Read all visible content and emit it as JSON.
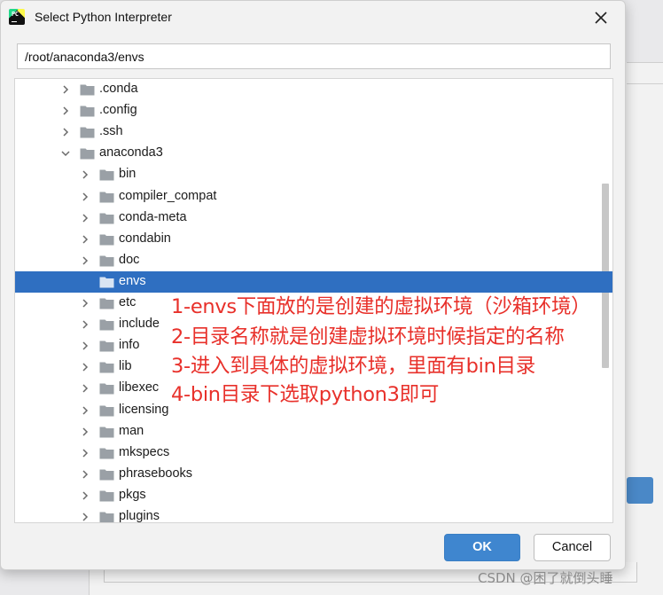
{
  "dialog": {
    "title": "Select Python Interpreter",
    "app_icon_text": "PC",
    "path": "/root/anaconda3/envs"
  },
  "tree": {
    "rows": [
      {
        "label": ".conda",
        "depth": 0,
        "expanded": false,
        "selected": false
      },
      {
        "label": ".config",
        "depth": 0,
        "expanded": false,
        "selected": false
      },
      {
        "label": ".ssh",
        "depth": 0,
        "expanded": false,
        "selected": false
      },
      {
        "label": "anaconda3",
        "depth": 0,
        "expanded": true,
        "selected": false
      },
      {
        "label": "bin",
        "depth": 1,
        "expanded": false,
        "selected": false
      },
      {
        "label": "compiler_compat",
        "depth": 1,
        "expanded": false,
        "selected": false
      },
      {
        "label": "conda-meta",
        "depth": 1,
        "expanded": false,
        "selected": false
      },
      {
        "label": "condabin",
        "depth": 1,
        "expanded": false,
        "selected": false
      },
      {
        "label": "doc",
        "depth": 1,
        "expanded": false,
        "selected": false
      },
      {
        "label": "envs",
        "depth": 1,
        "expanded": false,
        "selected": true,
        "no_chevron": true
      },
      {
        "label": "etc",
        "depth": 1,
        "expanded": false,
        "selected": false
      },
      {
        "label": "include",
        "depth": 1,
        "expanded": false,
        "selected": false
      },
      {
        "label": "info",
        "depth": 1,
        "expanded": false,
        "selected": false
      },
      {
        "label": "lib",
        "depth": 1,
        "expanded": false,
        "selected": false
      },
      {
        "label": "libexec",
        "depth": 1,
        "expanded": false,
        "selected": false
      },
      {
        "label": "licensing",
        "depth": 1,
        "expanded": false,
        "selected": false
      },
      {
        "label": "man",
        "depth": 1,
        "expanded": false,
        "selected": false
      },
      {
        "label": "mkspecs",
        "depth": 1,
        "expanded": false,
        "selected": false
      },
      {
        "label": "phrasebooks",
        "depth": 1,
        "expanded": false,
        "selected": false
      },
      {
        "label": "pkgs",
        "depth": 1,
        "expanded": false,
        "selected": false
      },
      {
        "label": "plugins",
        "depth": 1,
        "expanded": false,
        "selected": false
      }
    ]
  },
  "annotations": [
    "1-envs下面放的是创建的虚拟环境（沙箱环境）",
    "2-目录名称就是创建虚拟环境时候指定的名称",
    "3-进入到具体的虚拟环境，里面有bin目录",
    "4-bin目录下选取python3即可"
  ],
  "buttons": {
    "ok": "OK",
    "cancel": "Cancel"
  },
  "watermark": "CSDN @困了就倒头睡",
  "colors": {
    "selection": "#2f6fc1",
    "ok_button": "#3f86cf",
    "annotation": "#e8302a"
  }
}
